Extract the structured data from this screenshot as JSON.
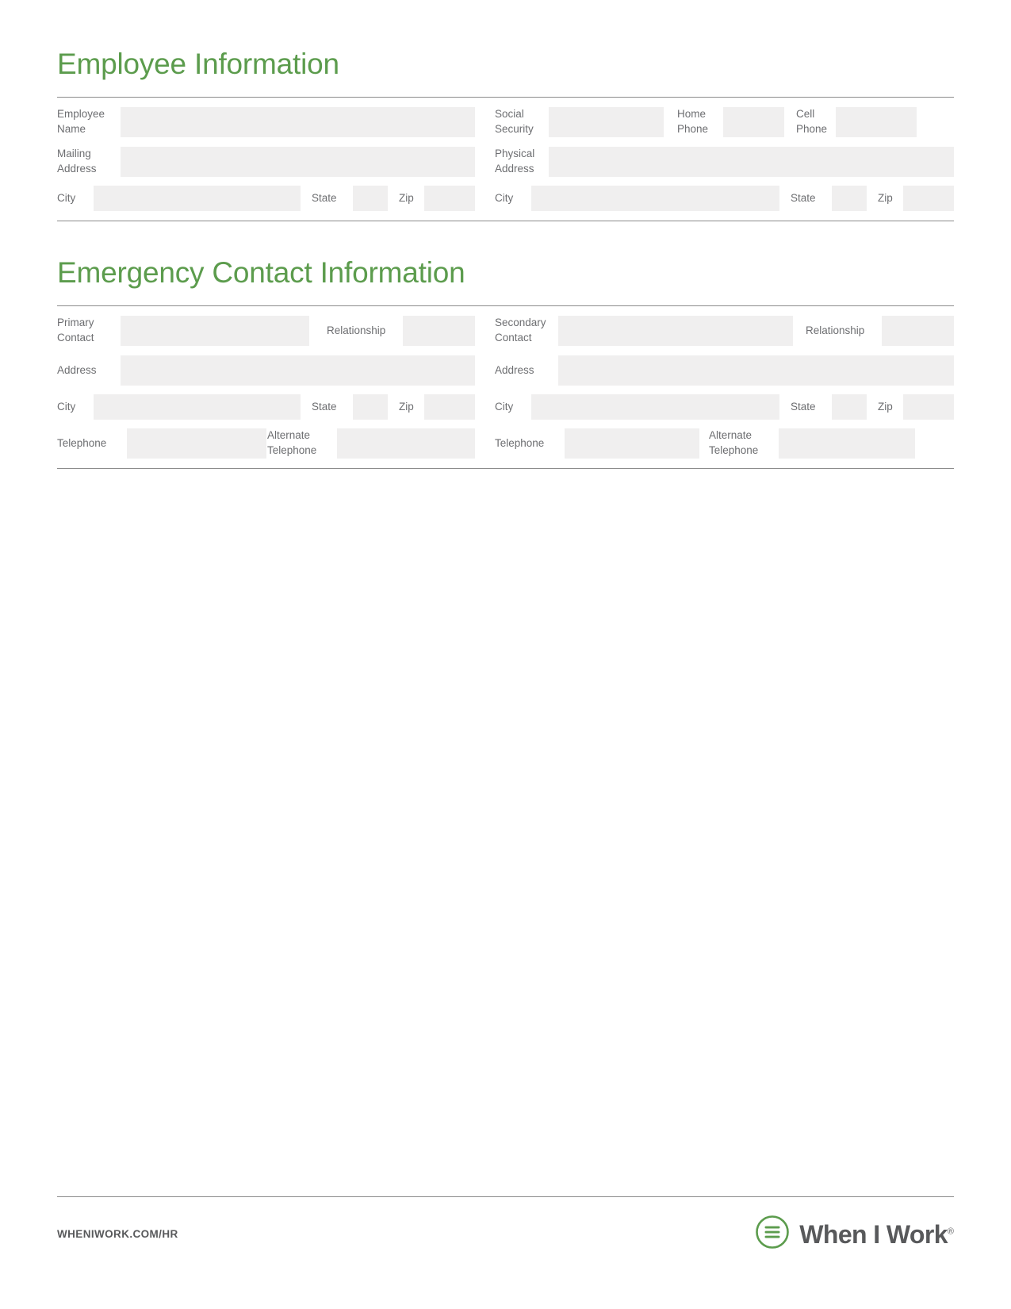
{
  "document": {
    "sections": [
      {
        "id": "employee-information",
        "title": "Employee Information",
        "left_column": {
          "rows": [
            {
              "labels": [
                "Employee\nName"
              ],
              "fields": [
                "employee-name"
              ]
            },
            {
              "labels": [
                "Mailing\nAddress"
              ],
              "fields": [
                "mailing-address"
              ]
            },
            {
              "labels": [
                "City",
                "State",
                "Zip"
              ],
              "fields": [
                "city",
                "state",
                "zip"
              ]
            }
          ]
        },
        "right_column": {
          "rows": [
            {
              "labels": [
                "Social\nSecurity",
                "Home\nPhone",
                "Cell\nPhone"
              ],
              "fields": [
                "social-security",
                "home-phone",
                "cell-phone"
              ]
            },
            {
              "labels": [
                "Physical\nAddress"
              ],
              "fields": [
                "physical-address"
              ]
            },
            {
              "labels": [
                "City",
                "State",
                "Zip"
              ],
              "fields": [
                "city",
                "state",
                "zip"
              ]
            }
          ]
        }
      },
      {
        "id": "emergency-contact-information",
        "title": "Emergency Contact Information",
        "left_column": {
          "rows": [
            {
              "labels": [
                "Primary\nContact",
                "Relationship"
              ],
              "fields": [
                "primary-contact",
                "relationship"
              ]
            },
            {
              "labels": [
                "Address"
              ],
              "fields": [
                "address"
              ]
            },
            {
              "labels": [
                "City",
                "State",
                "Zip"
              ],
              "fields": [
                "city",
                "state",
                "zip"
              ]
            },
            {
              "labels": [
                "Telephone",
                "Alternate\nTelephone"
              ],
              "fields": [
                "telephone",
                "alternate-telephone"
              ]
            }
          ]
        },
        "right_column": {
          "rows": [
            {
              "labels": [
                "Secondary\nContact",
                "Relationship"
              ],
              "fields": [
                "secondary-contact",
                "relationship"
              ]
            },
            {
              "labels": [
                "Address"
              ],
              "fields": [
                "address"
              ]
            },
            {
              "labels": [
                "City",
                "State",
                "Zip"
              ],
              "fields": [
                "city",
                "state",
                "zip"
              ]
            },
            {
              "labels": [
                "Telephone",
                "Alternate\nTelephone"
              ],
              "fields": [
                "telephone",
                "alternate-telephone"
              ]
            }
          ]
        }
      }
    ]
  },
  "labels": {
    "employee_name": "Employee\nName",
    "mailing_address": "Mailing\nAddress",
    "city": "City",
    "state": "State",
    "zip": "Zip",
    "social_security": "Social\nSecurity",
    "home_phone": "Home\nPhone",
    "cell_phone": "Cell\nPhone",
    "physical_address": "Physical\nAddress",
    "primary_contact": "Primary\nContact",
    "secondary_contact": "Secondary\nContact",
    "relationship": "Relationship",
    "address": "Address",
    "telephone": "Telephone",
    "alternate_telephone": "Alternate\nTelephone"
  },
  "headings": {
    "employee_information": "Employee Information",
    "emergency_contact_information": "Emergency Contact Information"
  },
  "footer": {
    "url": "WHENIWORK.COM/HR",
    "logo_text": "When I Work",
    "logo_registered": "®",
    "logo_icon": "hamburger-circle-icon"
  },
  "colors": {
    "heading_green": "#5c9c4d",
    "logo_green": "#5c9c4d",
    "field_fill": "#f0efef",
    "rule": "#8b8b8b",
    "label_text": "#6d6e71",
    "footer_text": "#58595b"
  },
  "field_values": {
    "employee_name": "",
    "social_security": "",
    "home_phone": "",
    "cell_phone": "",
    "mailing_address": "",
    "physical_address": "",
    "mailing_city": "",
    "mailing_state": "",
    "mailing_zip": "",
    "physical_city": "",
    "physical_state": "",
    "physical_zip": "",
    "primary_contact": "",
    "primary_relationship": "",
    "primary_address": "",
    "primary_city": "",
    "primary_state": "",
    "primary_zip": "",
    "primary_telephone": "",
    "primary_alternate_telephone": "",
    "secondary_contact": "",
    "secondary_relationship": "",
    "secondary_address": "",
    "secondary_city": "",
    "secondary_state": "",
    "secondary_zip": "",
    "secondary_telephone": "",
    "secondary_alternate_telephone": ""
  }
}
